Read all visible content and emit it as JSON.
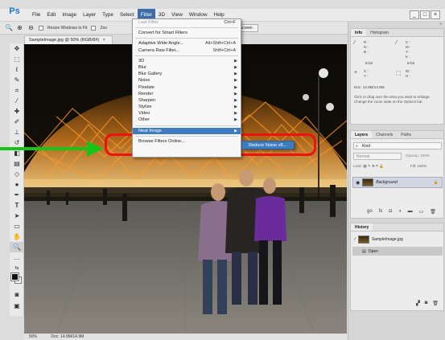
{
  "app": {
    "logo": "Ps",
    "menus": [
      "File",
      "Edit",
      "Image",
      "Layer",
      "Type",
      "Select",
      "Filter",
      "3D",
      "View",
      "Window",
      "Help"
    ],
    "active_menu": "Filter",
    "window_buttons": [
      "_",
      "□",
      "×"
    ]
  },
  "options_bar": {
    "resize_windows_label": "Resize Windows to Fit",
    "zoom_all_label": "Zoo",
    "fill_screen_label": "Fill Screen"
  },
  "document": {
    "tab_title": "SampleImage.jpg @ 50% (RGB/8#)",
    "tab_close": "×",
    "status_zoom": "50%",
    "status_doc": "Doc: 14.9M/14.9M"
  },
  "filter_menu": {
    "items": [
      {
        "label": "Last Filter",
        "shortcut": "Ctrl+F",
        "disabled": true
      },
      {
        "sep": true
      },
      {
        "label": "Convert for Smart Filters"
      },
      {
        "sep": true
      },
      {
        "label": "Adaptive Wide Angle...",
        "shortcut": "Alt+Shift+Ctrl+A"
      },
      {
        "label": "Camera Raw Filter...",
        "shortcut": "Shift+Ctrl+A"
      },
      {
        "sep": true
      },
      {
        "label": "3D",
        "submenu": true
      },
      {
        "label": "Blur",
        "submenu": true
      },
      {
        "label": "Blur Gallery",
        "submenu": true
      },
      {
        "label": "Noise",
        "submenu": true
      },
      {
        "label": "Pixelate",
        "submenu": true
      },
      {
        "label": "Render",
        "submenu": true
      },
      {
        "label": "Sharpen",
        "submenu": true
      },
      {
        "label": "Stylize",
        "submenu": true
      },
      {
        "label": "Video",
        "submenu": true
      },
      {
        "label": "Other",
        "submenu": true
      },
      {
        "sep": true
      },
      {
        "label": "Neat Image",
        "submenu": true,
        "highlight": true
      },
      {
        "sep": true
      },
      {
        "label": "Browse Filters Online..."
      }
    ],
    "submenu_item": "Reduce Noise v8..."
  },
  "info_panel": {
    "tabs": [
      "Info",
      "Histogram"
    ],
    "left_labels": [
      "R :",
      "G :",
      "B :"
    ],
    "right_labels": [
      "C :",
      "M :",
      "Y :",
      "K :"
    ],
    "bit_left": "8-bit",
    "bit_right": "8-bit",
    "xy_left": [
      "X :",
      "Y :"
    ],
    "wh_right": [
      "W :",
      "H :"
    ],
    "doc_size": "Doc: 14.9M/14.9M",
    "hint": "Click or drag over the area you want to enlarge. Change the zoom state on the Options bar."
  },
  "layers_panel": {
    "tabs": [
      "Layers",
      "Channels",
      "Paths"
    ],
    "kind_label": "Kind",
    "blend_mode": "Normal",
    "opacity_label": "Opacity:",
    "opacity_value": "100%",
    "lock_label": "Lock:",
    "fill_label": "Fill:",
    "fill_value": "100%",
    "layer_name": "Background",
    "footer_icons": [
      "go",
      "fx"
    ]
  },
  "history_panel": {
    "title": "History",
    "snapshot": "SampleImage.jpg",
    "step": "Open"
  },
  "colors": {
    "menu_highlight": "#3e7cc0",
    "annotation_red": "#f01010",
    "annotation_green": "#19c419"
  }
}
